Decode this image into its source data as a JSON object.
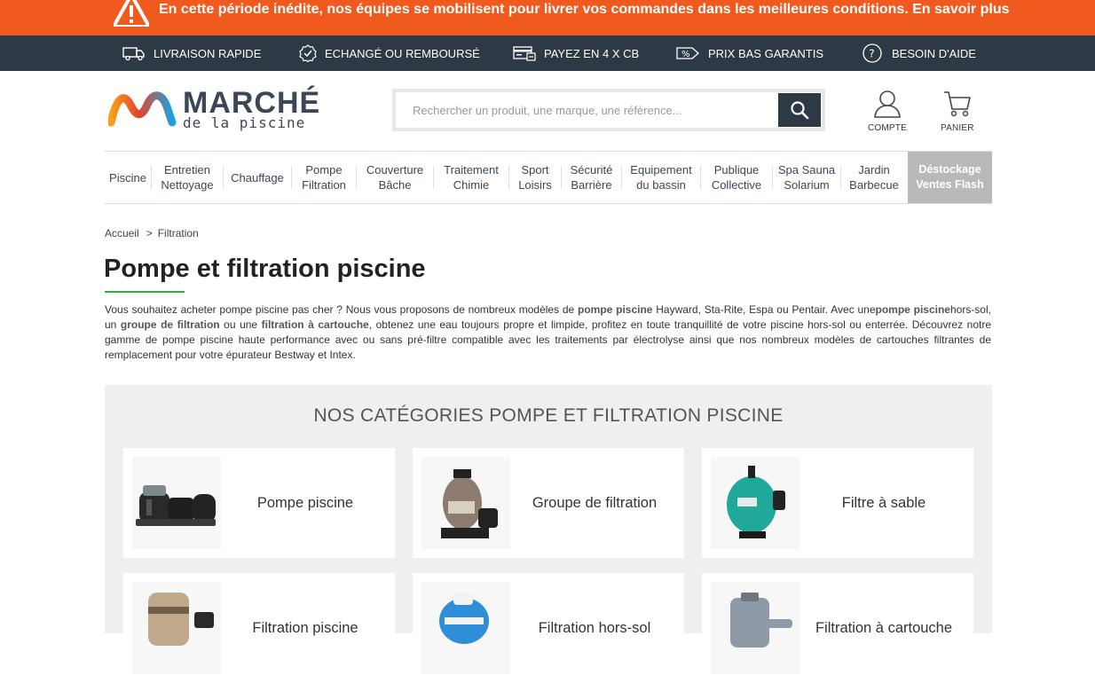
{
  "alert": {
    "text": "En cette période inédite, nos équipes se mobilisent pour livrer vos commandes dans les meilleures conditions. En savoir plus",
    "icon": "warning-icon"
  },
  "services": [
    {
      "label": "LIVRAISON RAPIDE",
      "icon": "truck-icon"
    },
    {
      "label": "ECHANGÉ OU REMBOURSÉ",
      "icon": "check-badge-icon"
    },
    {
      "label": "PAYEZ EN 4 X CB",
      "icon": "card-icon"
    },
    {
      "label": "PRIX BAS GARANTIS",
      "icon": "price-tag-icon"
    },
    {
      "label": "BESOIN D'AIDE",
      "icon": "help-icon"
    }
  ],
  "logo": {
    "word": "MARCHÉ",
    "sub": "de la piscine"
  },
  "search": {
    "placeholder": "Rechercher un produit, une marque, une référence..."
  },
  "header_icons": {
    "account_label": "COMPTE",
    "cart_label": "PANIER"
  },
  "nav": [
    "Piscine",
    "Entretien\nNettoyage",
    "Chauffage",
    "Pompe\nFiltration",
    "Couverture\nBâche",
    "Traitement\nChimie",
    "Sport\nLoisirs",
    "Sécurité\nBarrière",
    "Equipement\ndu bassin",
    "Publique\nCollective",
    "Spa Sauna\nSolarium",
    "Jardin\nBarbecue",
    "Déstockage\nVentes Flash"
  ],
  "breadcrumb": {
    "home": "Accueil",
    "separator": ">",
    "current": "Filtration"
  },
  "page_title": "Pompe et filtration piscine",
  "intro": {
    "t1": "Vous souhaitez acheter pompe piscine pas cher ? Nous vous proposons de nombreux modèles de ",
    "b1": "pompe piscine",
    "t2": " Hayward, Sta-Rite, Espa ou Pentair. Avec une",
    "b2": "pompe piscine",
    "t3": "hors-sol, un ",
    "b3": "groupe de filtration",
    "t4": " ou une ",
    "b4": "filtration à cartouche",
    "t5": ", obtenez une eau toujours propre et limpide, profitez en toute tranquillité de votre piscine hors-sol ou enterrée. Découvrez notre gamme de pompe piscine haute performance avec ou sans pré-filtre compatible avec les traitements par électrolyse ainsi que nos nombreux modèles de cartouches filtrantes de remplacement pour votre épurateur Bestway et Intex."
  },
  "categories_title": "NOS CATÉGORIES POMPE ET FILTRATION PISCINE",
  "categories": [
    {
      "label": "Pompe piscine"
    },
    {
      "label": "Groupe de filtration"
    },
    {
      "label": "Filtre à sable"
    },
    {
      "label": "Filtration piscine"
    },
    {
      "label": "Filtration hors-sol"
    },
    {
      "label": "Filtration à cartouche"
    }
  ],
  "colors": {
    "alert_bg": "#f05a1e",
    "service_bg": "#2d3a45",
    "accent_green": "#3fa64a",
    "flash_bg": "#b9b9b9",
    "panel_bg": "#efefef"
  }
}
